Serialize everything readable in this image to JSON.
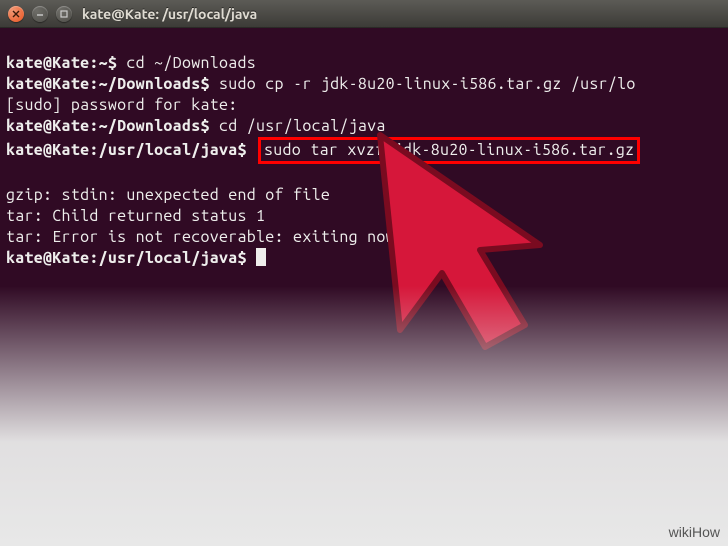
{
  "titlebar": {
    "title": "kate@Kate: /usr/local/java"
  },
  "prompt": {
    "p1": "kate@Kate:~$ ",
    "p2": "kate@Kate:~/Downloads$ ",
    "p3": "kate@Kate:/usr/local/java$ "
  },
  "commands": {
    "cmd1": "cd ~/Downloads",
    "cmd2": "sudo cp -r jdk-8u20-linux-i586.tar.gz /usr/lo",
    "cmd3": "cd /usr/local/java",
    "cmd4": "sudo tar xvzf jdk-8u20-linux-i586.tar.gz"
  },
  "output": {
    "sudo_prompt": "[sudo] password for kate:",
    "blank": "",
    "err1": "gzip: stdin: unexpected end of file",
    "err2": "tar: Child returned status 1",
    "err3": "tar: Error is not recoverable: exiting now"
  },
  "watermark": "wikiHow"
}
